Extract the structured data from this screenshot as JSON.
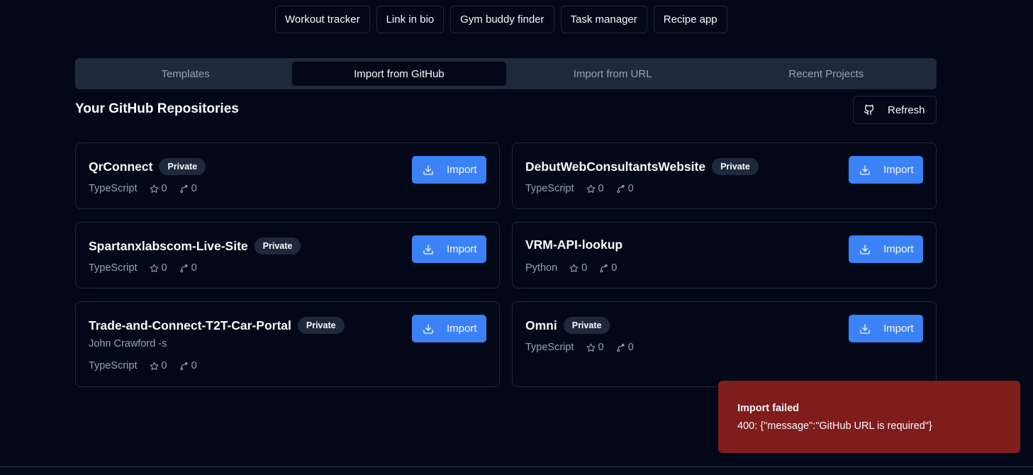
{
  "chips": [
    "Workout tracker",
    "Link in bio",
    "Gym buddy finder",
    "Task manager",
    "Recipe app"
  ],
  "tabs": [
    {
      "label": "Templates",
      "active": false
    },
    {
      "label": "Import from GitHub",
      "active": true
    },
    {
      "label": "Import from URL",
      "active": false
    },
    {
      "label": "Recent Projects",
      "active": false
    }
  ],
  "section_title": "Your GitHub Repositories",
  "refresh_label": "Refresh",
  "import_label": "Import",
  "repos": [
    {
      "name": "QrConnect",
      "badge": "Private",
      "description": "",
      "language": "TypeScript",
      "stars": "0",
      "forks": "0"
    },
    {
      "name": "DebutWebConsultantsWebsite",
      "badge": "Private",
      "description": "",
      "language": "TypeScript",
      "stars": "0",
      "forks": "0"
    },
    {
      "name": "Spartanxlabscom-Live-Site",
      "badge": "Private",
      "description": "",
      "language": "TypeScript",
      "stars": "0",
      "forks": "0"
    },
    {
      "name": "VRM-API-lookup",
      "badge": "",
      "description": "",
      "language": "Python",
      "stars": "0",
      "forks": "0"
    },
    {
      "name": "Trade-and-Connect-T2T-Car-Portal",
      "badge": "Private",
      "description": "John Crawford -s",
      "language": "TypeScript",
      "stars": "0",
      "forks": "0"
    },
    {
      "name": "Omni",
      "badge": "Private",
      "description": "",
      "language": "TypeScript",
      "stars": "0",
      "forks": "0"
    }
  ],
  "toast": {
    "title": "Import failed",
    "message": "400: {\"message\":\"GitHub URL is required\"}"
  },
  "colors": {
    "accent": "#3b82f6",
    "error": "#7f1d1d",
    "background": "#020817",
    "muted": "#1e293b"
  },
  "icons": {
    "refresh": "github-icon",
    "import": "download-icon",
    "stars": "star-icon",
    "forks": "git-fork-icon"
  }
}
